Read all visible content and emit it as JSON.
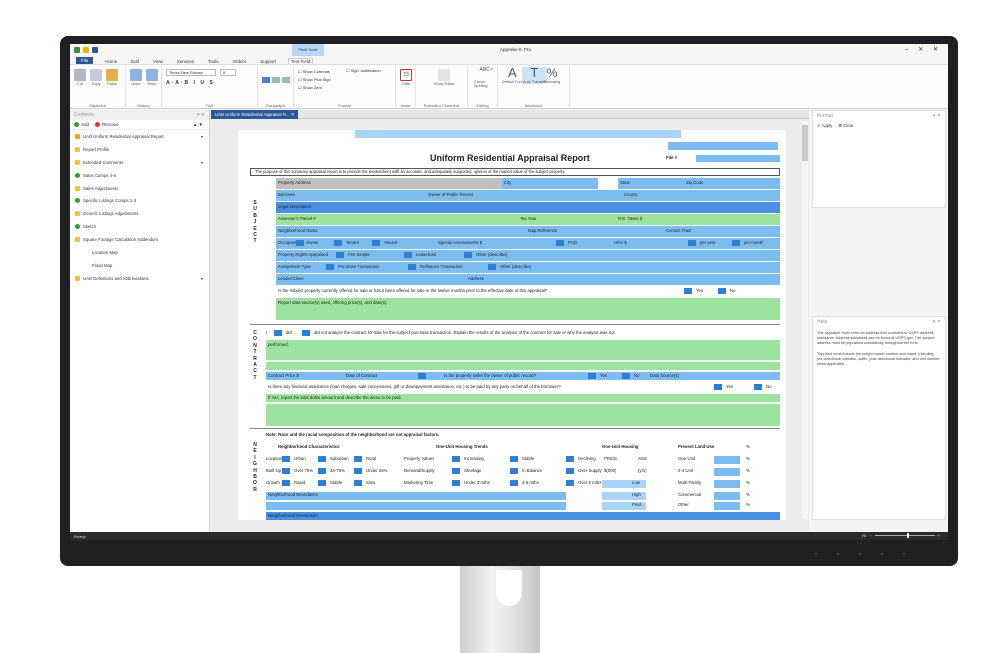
{
  "app": {
    "title": "Appraise It. Pro",
    "context_tab_group": "Field Tools",
    "window_controls": "– ✕ ✕"
  },
  "menu": {
    "items": [
      "File",
      "Home",
      "Edit",
      "View",
      "Services",
      "Tools",
      "Orders",
      "Support",
      "Text Field"
    ]
  },
  "ribbon": {
    "font_name": "Times New Roman",
    "font_size": "8",
    "groups": [
      "Clipboard",
      "History",
      "Font",
      "Paragraph",
      "Format",
      "Insert",
      "Extended Comment",
      "Editing",
      "Advanced"
    ],
    "buttons": {
      "cut": "Cut",
      "copy": "Copy",
      "paste": "Paste",
      "undo": "Undo",
      "redo": "Redo",
      "date": "Date",
      "show_editor": "Show Editor",
      "check_spelling": "Check Spelling",
      "default_font": "Default Font",
      "auto_transfer": "Auto Transfer",
      "rounding": "Rounding"
    },
    "checkboxes": [
      "Show Commas",
      "Show Plus Sign",
      "Show Zero",
      "Sign Justification"
    ],
    "date_icon": "23"
  },
  "contents": {
    "title": "Contents",
    "add": "Add",
    "remove": "Remove",
    "items": [
      {
        "label": "UAD Uniform Residential Appraisal Report",
        "icon": "star-icon",
        "chev": "▾"
      },
      {
        "label": "Report Profile",
        "icon": "lock-icon"
      },
      {
        "label": "Extended Comments",
        "icon": "lock-icon",
        "chev": "▾"
      },
      {
        "label": "Sales Comps 4-6",
        "icon": "plus-circle-icon"
      },
      {
        "label": "Sales Adjustments",
        "icon": "lock-icon"
      },
      {
        "label": "Specific Listings Comps 1-3",
        "icon": "plus-circle-icon"
      },
      {
        "label": "Generic Listings Adjustments",
        "icon": "lock-icon"
      },
      {
        "label": "Sketch",
        "icon": "plus-circle-icon"
      },
      {
        "label": "Square Footage Calculation Addendum",
        "icon": "lock-icon"
      },
      {
        "label": "Location Map",
        "icon": "none",
        "indent": true
      },
      {
        "label": "Flood Map",
        "icon": "none",
        "indent": true
      },
      {
        "label": "UAD Definitions and Abbreviations",
        "icon": "lock-icon",
        "chev": "▾"
      }
    ]
  },
  "document": {
    "tab": "UAD Uniform Residential Appraisal R...",
    "title": "Uniform Residential Appraisal Report",
    "file_label": "File #",
    "purpose": "The purpose of this summary appraisal report is to provide the lender/client with an accurate, and adequately supported, opinion of the market value of the subject property.",
    "subject_letters": [
      "S",
      "U",
      "B",
      "J",
      "E",
      "C",
      "T"
    ],
    "contract_letters": [
      "C",
      "O",
      "N",
      "T",
      "R",
      "A",
      "C",
      "T"
    ],
    "neigh_letters": [
      "N",
      "E",
      "I",
      "G",
      "H",
      "B",
      "O",
      "R"
    ],
    "labels": {
      "property_address": "Property Address",
      "city": "City",
      "state": "State",
      "zip": "Zip Code",
      "borrower": "Borrower",
      "owner": "Owner of Public Record",
      "county": "County",
      "legal": "Legal Description",
      "apn": "Assessor's Parcel #",
      "tax_year": "Tax Year",
      "re_taxes": "R.E. Taxes $",
      "neigh_name": "Neighborhood Name",
      "map_ref": "Map Reference",
      "census": "Census Tract",
      "occupant": "Occupant",
      "owner_c": "Owner",
      "tenant": "Tenant",
      "vacant": "Vacant",
      "special": "Special Assessments $",
      "pud": "PUD",
      "hoa": "HOA $",
      "per_year": "per year",
      "per_month": "per month",
      "rights": "Property Rights Appraised",
      "fee": "Fee Simple",
      "leasehold": "Leasehold",
      "other_describe": "Other (describe)",
      "assignment": "Assignment Type",
      "purchase": "Purchase Transaction",
      "refinance": "Refinance Transaction",
      "other_describe2": "Other (describe)",
      "lender": "Lender/Client",
      "address": "Address",
      "offered": "Is the subject property currently offered for sale or has it been offered for sale in the twelve months prior to the effective date of this appraisal?",
      "yes": "Yes",
      "no": "No",
      "report_data": "Report data source(s) used, offering price(s), and date(s).",
      "i": "I",
      "did": "did",
      "did_not": "did not analyze the contract for sale for the subject purchase transaction. Explain the results of the analysis of the contract for sale or why the analysis was not",
      "performed": "performed.",
      "contract_price": "Contract Price $",
      "date_contract": "Date of Contract",
      "seller": "Is the property seller the owner of public record?",
      "data_sources": "Data Source(s)",
      "financial": "Is there any financial assistance (loan charges, sale concessions, gift or downpayment assistance, etc.) to be paid by any party on behalf of the borrower?",
      "if_yes": "If Yes, report the total dollar amount and describe the items to be paid.",
      "race_note": "Note: Race and the racial composition of the neighborhood are not appraisal factors.",
      "nc": "Neighborhood Characteristics",
      "oneunit_trends": "One-Unit Housing Trends",
      "oneunit": "One-Unit Housing",
      "present_land": "Present Land Use",
      "pct": "%",
      "location": "Location",
      "urban": "Urban",
      "suburban": "Suburban",
      "rural": "Rural",
      "prop_values": "Property Values",
      "increasing": "Increasing",
      "stable": "Stable",
      "declining": "Declining",
      "price": "PRICE",
      "age": "AGE",
      "one_unit": "One-Unit",
      "built_up": "Built-Up",
      "over75": "Over 75%",
      "r25_75": "25-75%",
      "under25": "Under 25%",
      "demand": "Demand/Supply",
      "shortage": "Shortage",
      "in_balance": "In Balance",
      "over_supply": "Over Supply",
      "thousands": "$(000)",
      "yrs": "(yrs)",
      "two_four": "2-4 Unit",
      "growth": "Growth",
      "rapid": "Rapid",
      "stable2": "Stable",
      "slow": "Slow",
      "marketing": "Marketing Time",
      "under3": "Under 3 mths",
      "r3_6": "3-6 mths",
      "over6": "Over 6 mths",
      "low": "Low",
      "multi": "Multi-Family",
      "boundaries": "Neighborhood Boundaries",
      "high": "High",
      "commercial": "Commercial",
      "pred": "Pred.",
      "other": "Other",
      "description": "Neighborhood Description"
    }
  },
  "format_pane": {
    "title": "Format",
    "apply": "Apply",
    "clear": "Clear"
  },
  "help_pane": {
    "title": "Help",
    "text": "The appraiser must enter an address that conforms to USPS address standards. Address standards can be found at USPS.gov. The subject address must be populated consistently throughout the form.\n\nThis field must include the subject street number and name, including pre-directional indicator, suffix, post-directional indicator, and unit number when applicable."
  },
  "status": {
    "left": "Ready",
    "zoom": "Fit"
  },
  "colors": {
    "green": "#9de39f",
    "blue": "#7bbdf0",
    "dark_blue": "#4a90e2",
    "accent": "#2b579a"
  }
}
